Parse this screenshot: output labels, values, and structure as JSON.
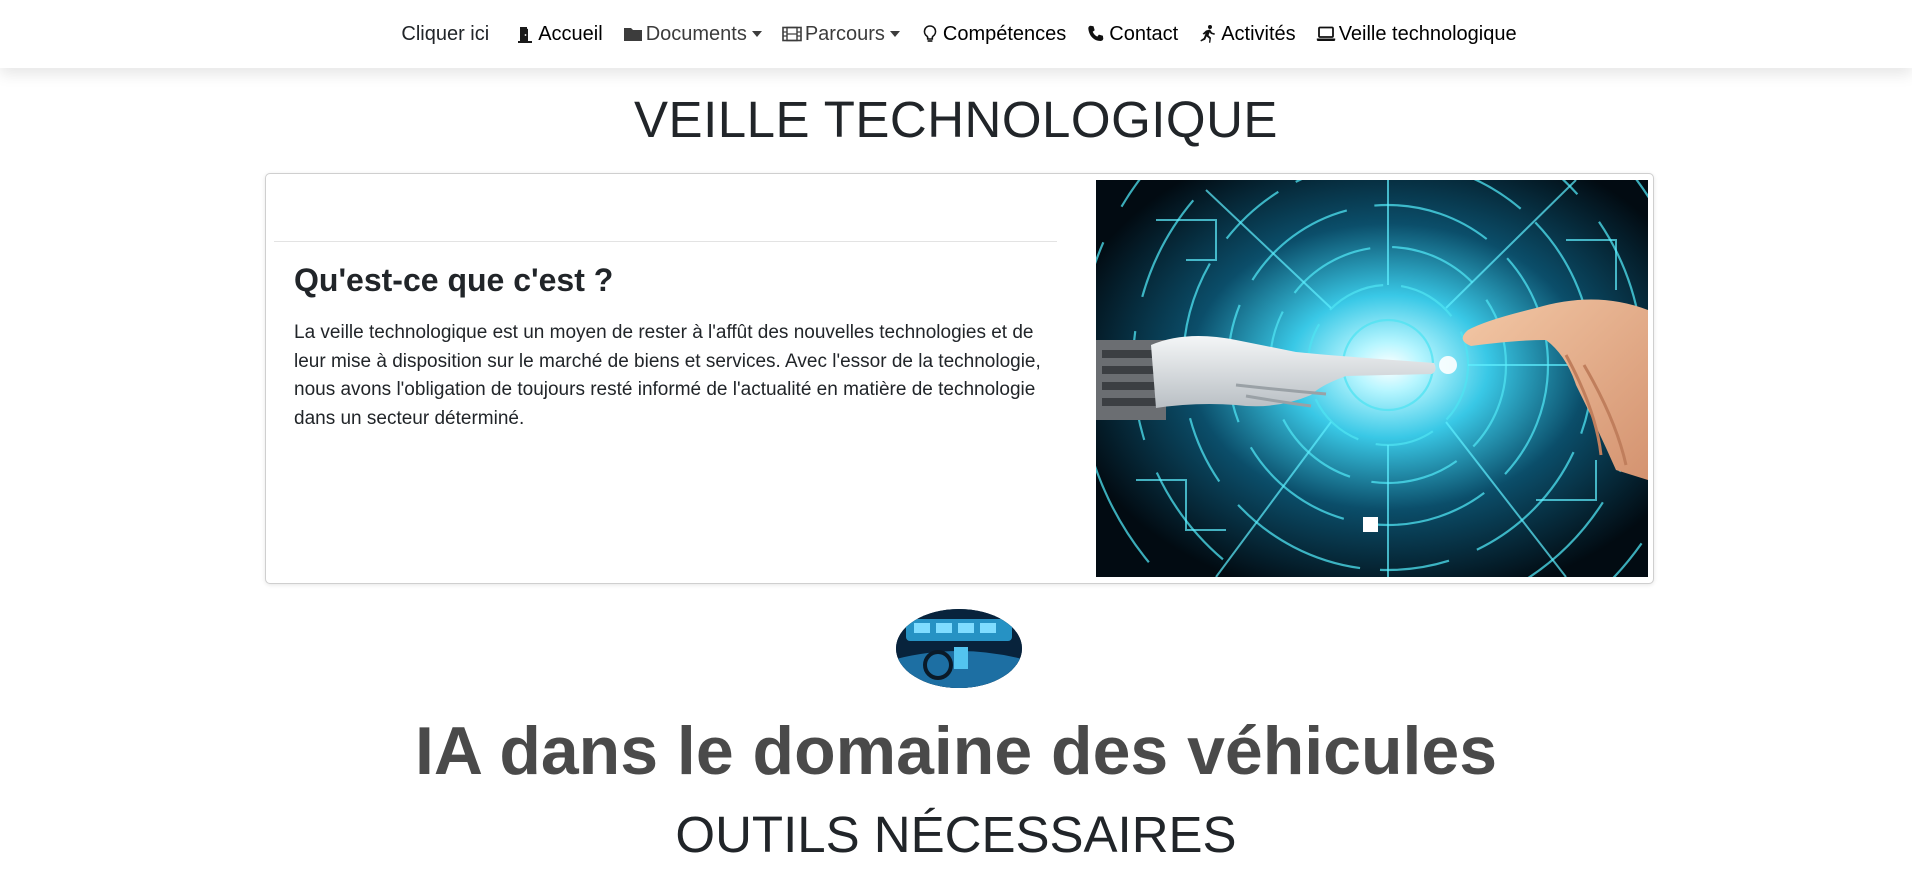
{
  "navbar": {
    "brand": "Cliquer ici",
    "items": [
      {
        "label": "Accueil",
        "icon": "door-open-icon",
        "dropdown": false
      },
      {
        "label": "Documents",
        "icon": "folder-icon",
        "dropdown": true
      },
      {
        "label": "Parcours",
        "icon": "film-icon",
        "dropdown": true
      },
      {
        "label": "Compétences",
        "icon": "lightbulb-icon",
        "dropdown": false
      },
      {
        "label": "Contact",
        "icon": "phone-icon",
        "dropdown": false
      },
      {
        "label": "Activités",
        "icon": "running-person-icon",
        "dropdown": false
      },
      {
        "label": "Veille technologique",
        "icon": "laptop-icon",
        "dropdown": false
      }
    ]
  },
  "page_title": "VEILLE TECHNOLOGIQUE",
  "card": {
    "heading": "Qu'est-ce que c'est ?",
    "text": "La veille technologique est un moyen de rester à l'affût des nouvelles technologies et de leur mise à disposition sur le marché de biens et services. Avec l'essor de la technologie, nous avons l'obligation de toujours resté informé de l'actualité en matière de technologie dans un secteur déterminé."
  },
  "section": {
    "title": "IA dans le domaine des véhicules",
    "subtitle": "OUTILS NÉCESSAIRES"
  },
  "colors": {
    "text": "#212529",
    "title_gray": "#4a4a4a",
    "card_border": "#cfcfcf",
    "circuit_cyan": "#3fe0f0"
  }
}
